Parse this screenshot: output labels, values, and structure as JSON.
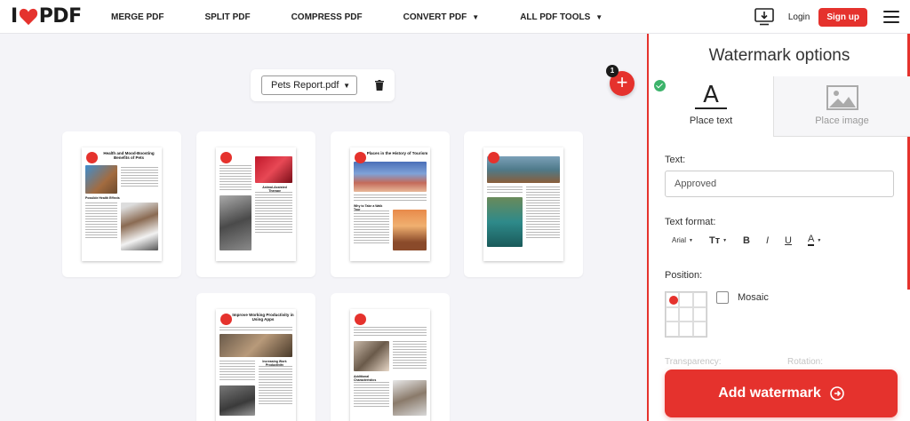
{
  "header": {
    "logo_left": "I",
    "logo_right": "PDF",
    "nav": [
      "MERGE PDF",
      "SPLIT PDF",
      "COMPRESS PDF",
      "CONVERT PDF",
      "ALL PDF TOOLS"
    ],
    "login": "Login",
    "signup": "Sign up",
    "icons": [
      "heart-icon",
      "desktop-download-icon",
      "menu-icon"
    ]
  },
  "file": {
    "name": "Pets Report.pdf",
    "icons": [
      "chevron-down-icon",
      "trash-icon"
    ]
  },
  "add": {
    "badge": "1",
    "label": "+"
  },
  "pages": [
    {
      "title": "Health and Mood-Boosting Benefits of Pets",
      "subheading": "Possible Health Effects"
    },
    {
      "title": "",
      "subheading": "Animal-Assisted Therapy"
    },
    {
      "title": "Places in the History of Tourism",
      "subheading": "Why to Take a Walk Tour"
    },
    {
      "title": "",
      "subheading": ""
    },
    {
      "title": "Improve Working Productivity in Using Apps",
      "subheading": "Increasing Work Productivity"
    },
    {
      "title": "",
      "subheading": "Additional Characteristics"
    }
  ],
  "panel": {
    "title": "Watermark options",
    "tab_text": "Place text",
    "tab_image": "Place image",
    "text_label": "Text:",
    "text_value": "Approved",
    "format_label": "Text format:",
    "font": "Arial",
    "format_tools": [
      "Tт",
      "B",
      "I",
      "U",
      "A"
    ],
    "position_label": "Position:",
    "mosaic": "Mosaic",
    "transparency": "Transparency:",
    "rotation": "Rotation:",
    "action": "Add watermark",
    "colors": {
      "accent": "#e5322d",
      "check": "#3cb36a"
    }
  }
}
